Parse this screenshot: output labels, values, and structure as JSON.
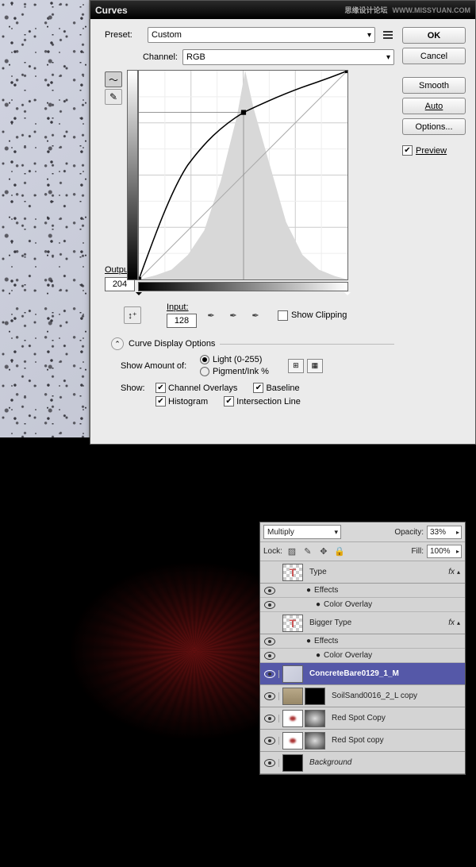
{
  "curves": {
    "title": "Curves",
    "watermark1": "思缘设计论坛",
    "watermark2": "WWW.MISSYUAN.COM",
    "preset_label": "Preset:",
    "preset_value": "Custom",
    "channel_label": "Channel:",
    "channel_value": "RGB",
    "output_label": "Output:",
    "output_value": "204",
    "input_label": "Input:",
    "input_value": "128",
    "show_clipping": "Show Clipping",
    "display_options": "Curve Display Options",
    "show_amount_label": "Show Amount of:",
    "light_label": "Light  (0-255)",
    "pigment_label": "Pigment/Ink %",
    "show_label": "Show:",
    "channel_overlays": "Channel Overlays",
    "baseline": "Baseline",
    "histogram": "Histogram",
    "intersection": "Intersection Line",
    "buttons": {
      "ok": "OK",
      "cancel": "Cancel",
      "smooth": "Smooth",
      "auto": "Auto",
      "options": "Options..."
    },
    "preview": "Preview"
  },
  "chart_data": {
    "type": "line",
    "title": "Curves",
    "xlabel": "Input",
    "ylabel": "Output",
    "xlim": [
      0,
      255
    ],
    "ylim": [
      0,
      255
    ],
    "series": [
      {
        "name": "curve",
        "x": [
          0,
          30,
          60,
          90,
          128,
          160,
          200,
          230,
          255
        ],
        "y": [
          0,
          80,
          140,
          180,
          204,
          220,
          235,
          245,
          255
        ]
      },
      {
        "name": "baseline",
        "x": [
          0,
          255
        ],
        "y": [
          0,
          255
        ]
      }
    ],
    "histogram": {
      "x": [
        0,
        20,
        40,
        60,
        80,
        100,
        120,
        130,
        140,
        160,
        180,
        200,
        220,
        240,
        255
      ],
      "y": [
        0,
        5,
        12,
        30,
        60,
        120,
        200,
        255,
        210,
        140,
        70,
        30,
        12,
        4,
        0
      ]
    },
    "control_point": {
      "input": 128,
      "output": 204
    }
  },
  "layers": {
    "blend_mode": "Multiply",
    "opacity_label": "Opacity:",
    "opacity_value": "33%",
    "lock_label": "Lock:",
    "fill_label": "Fill:",
    "fill_value": "100%",
    "fx_label": "fx",
    "effects_label": "Effects",
    "color_overlay": "Color Overlay",
    "items": [
      {
        "name": "Type",
        "visible": false,
        "fx": true,
        "thumb": "text"
      },
      {
        "name": "Bigger Type",
        "visible": false,
        "fx": true,
        "thumb": "text"
      },
      {
        "name": "ConcreteBare0129_1_M",
        "visible": true,
        "selected": true,
        "thumb": "concrete"
      },
      {
        "name": "SoilSand0016_2_L copy",
        "visible": true,
        "thumb": "soil",
        "mask": "black"
      },
      {
        "name": "Red Spot Copy",
        "visible": true,
        "thumb": "dot",
        "mask": "radial"
      },
      {
        "name": "Red Spot copy",
        "visible": true,
        "thumb": "dot",
        "mask": "radial"
      },
      {
        "name": "Background",
        "visible": true,
        "thumb": "black"
      }
    ]
  }
}
